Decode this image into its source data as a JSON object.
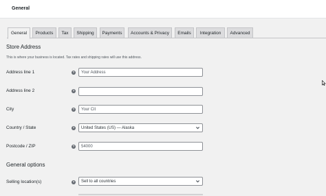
{
  "header": {
    "title": "General"
  },
  "tabs": [
    {
      "label": "General",
      "active": true
    },
    {
      "label": "Products"
    },
    {
      "label": "Tax"
    },
    {
      "label": "Shipping"
    },
    {
      "label": "Payments"
    },
    {
      "label": "Accounts & Privacy"
    },
    {
      "label": "Emails"
    },
    {
      "label": "Integration"
    },
    {
      "label": "Advanced"
    }
  ],
  "store_address": {
    "title": "Store Address",
    "description": "This is where your business is located. Tax rates and shipping rates will use this address.",
    "fields": {
      "address1": {
        "label": "Address line 1",
        "value": "Your Address"
      },
      "address2": {
        "label": "Address line 2",
        "value": ""
      },
      "city": {
        "label": "City",
        "value": "Your Cit"
      },
      "country": {
        "label": "Country / State",
        "value": "United States (US) — Alaska"
      },
      "postcode": {
        "label": "Postcode / ZIP",
        "value": "54000"
      }
    }
  },
  "general_options": {
    "title": "General options",
    "selling_location": {
      "label": "Selling location(s)",
      "value": "Sell to all countries"
    }
  },
  "icons": {
    "help": "help-tip-icon",
    "chevron": "chevron-down-icon",
    "cursor": "mouse-cursor-icon"
  },
  "colors": {
    "background": "#f1f1f1",
    "tab_inactive": "#dcdcde",
    "border": "#c3c4c7",
    "help_icon": "#646970"
  }
}
